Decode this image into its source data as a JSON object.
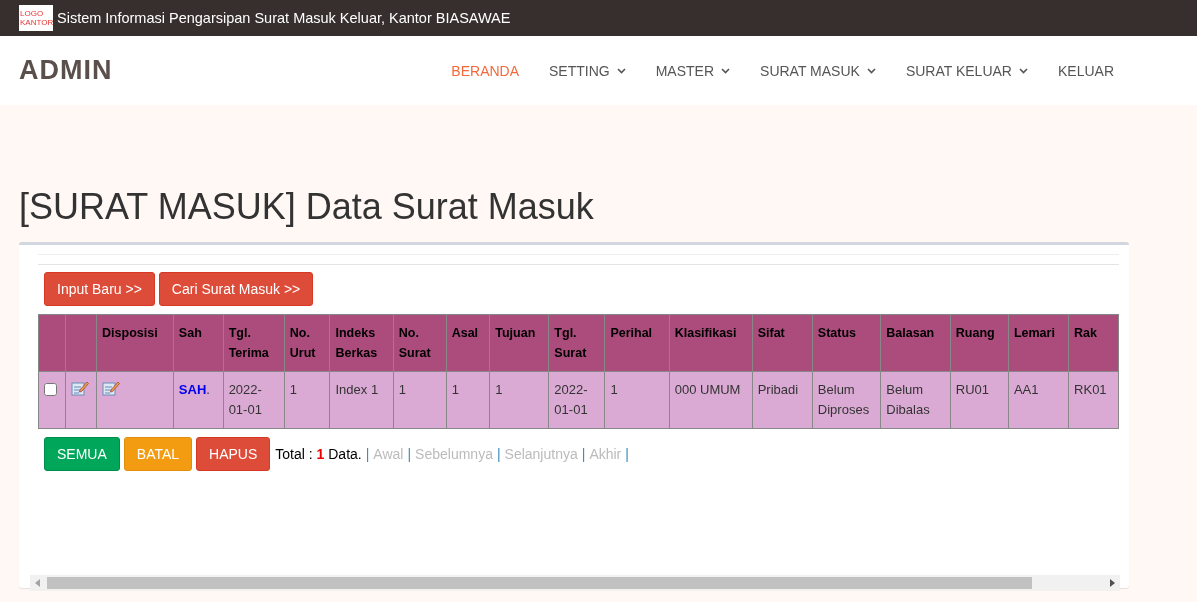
{
  "topbar": {
    "logo_text": "LOGO KANTOR",
    "title": "Sistem Informasi Pengarsipan Surat Masuk Keluar, Kantor BIASAWAE"
  },
  "navbar": {
    "brand": "ADMIN",
    "items": [
      {
        "label": "BERANDA",
        "kind": "link",
        "selected": true
      },
      {
        "label": "SETTING",
        "kind": "dropdown",
        "selected": false
      },
      {
        "label": "MASTER",
        "kind": "dropdown",
        "selected": false
      },
      {
        "label": "SURAT MASUK",
        "kind": "dropdown",
        "selected": false
      },
      {
        "label": "SURAT KELUAR",
        "kind": "dropdown",
        "selected": false
      },
      {
        "label": "KELUAR",
        "kind": "link",
        "selected": false
      }
    ]
  },
  "page_title": "[SURAT MASUK] Data Surat Masuk",
  "actions": [
    "Input Baru >>",
    "Cari Surat Masuk >>"
  ],
  "table": {
    "columns": [
      "",
      "",
      "Disposisi",
      "Sah",
      "Tgl. Terima",
      "No. Urut",
      "Indeks Berkas",
      "No. Surat",
      "Asal",
      "Tujuan",
      "Tgl. Surat",
      "Perihal",
      "Klasifikasi",
      "Sifat",
      "Status",
      "Balasan",
      "Ruang",
      "Lemari",
      "Rak"
    ],
    "rows": [
      {
        "checked": false,
        "cells": [
          "",
          "",
          "",
          "**SAH**.",
          "2022-01-01",
          "1",
          "Index 1",
          "1",
          "1",
          "1",
          "2022-01-01",
          "1",
          "000 UMUM",
          "Pribadi",
          "Belum Diproses",
          "Belum Dibalas",
          "RU01",
          "AA1",
          "RK01"
        ]
      }
    ]
  },
  "bulk_buttons": [
    {
      "label": "SEMUA",
      "kind": "success"
    },
    {
      "label": "BATAL",
      "kind": "warning"
    },
    {
      "label": "HAPUS",
      "kind": "danger"
    }
  ],
  "pagination": {
    "total_label": "Total :",
    "total_count": "1",
    "total_suffix": "Data.",
    "items": [
      {
        "kind": "separator",
        "text": "|"
      },
      {
        "kind": "link",
        "text": "Awal",
        "disabled": true
      },
      {
        "kind": "separator",
        "text": "|"
      },
      {
        "kind": "link",
        "text": "Sebelumnya",
        "disabled": true
      },
      {
        "kind": "separator",
        "text": "|"
      },
      {
        "kind": "link",
        "text": "Selanjutnya",
        "disabled": true
      },
      {
        "kind": "separator",
        "text": "|"
      },
      {
        "kind": "link",
        "text": "Akhir",
        "disabled": true
      },
      {
        "kind": "separator",
        "text": "|"
      }
    ]
  }
}
